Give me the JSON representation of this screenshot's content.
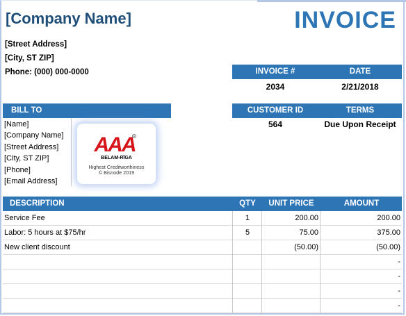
{
  "header": {
    "company_name": "[Company Name]",
    "title": "INVOICE",
    "street": "[Street Address]",
    "city": "[City, ST  ZIP]",
    "phone": "Phone: (000) 000-0000"
  },
  "invoice_info": {
    "invoice_no_label": "INVOICE #",
    "date_label": "DATE",
    "invoice_no": "2034",
    "date": "2/21/2018",
    "customer_id_label": "CUSTOMER ID",
    "terms_label": "TERMS",
    "customer_id": "564",
    "terms": "Due Upon Receipt"
  },
  "bill_to": {
    "label": "BILL TO",
    "lines": [
      "[Name]",
      "[Company Name]",
      "[Street Address]",
      "[City, ST  ZIP]",
      "[Phone]",
      "[Email Address]"
    ]
  },
  "badge": {
    "logo_text": "AAA",
    "name": "BELAM-RĪGA",
    "line1": "Highest Creditworthiness",
    "line2": "© Bisnode 2019",
    "accent_color": "#d7141a"
  },
  "table": {
    "headers": {
      "description": "DESCRIPTION",
      "qty": "QTY",
      "unit_price": "UNIT PRICE",
      "amount": "AMOUNT"
    },
    "rows": [
      {
        "description": "Service Fee",
        "qty": "1",
        "unit_price": "200.00",
        "amount": "200.00"
      },
      {
        "description": "Labor: 5 hours at $75/hr",
        "qty": "5",
        "unit_price": "75.00",
        "amount": "375.00"
      },
      {
        "description": "New client discount",
        "qty": "",
        "unit_price": "(50.00)",
        "amount": "(50.00)"
      },
      {
        "description": "",
        "qty": "",
        "unit_price": "",
        "amount": "-"
      },
      {
        "description": "",
        "qty": "",
        "unit_price": "",
        "amount": "-"
      },
      {
        "description": "",
        "qty": "",
        "unit_price": "",
        "amount": "-"
      },
      {
        "description": "",
        "qty": "",
        "unit_price": "",
        "amount": "-"
      }
    ]
  },
  "colors": {
    "header_blue": "#2e75b6",
    "company_navy": "#1f4e79"
  }
}
